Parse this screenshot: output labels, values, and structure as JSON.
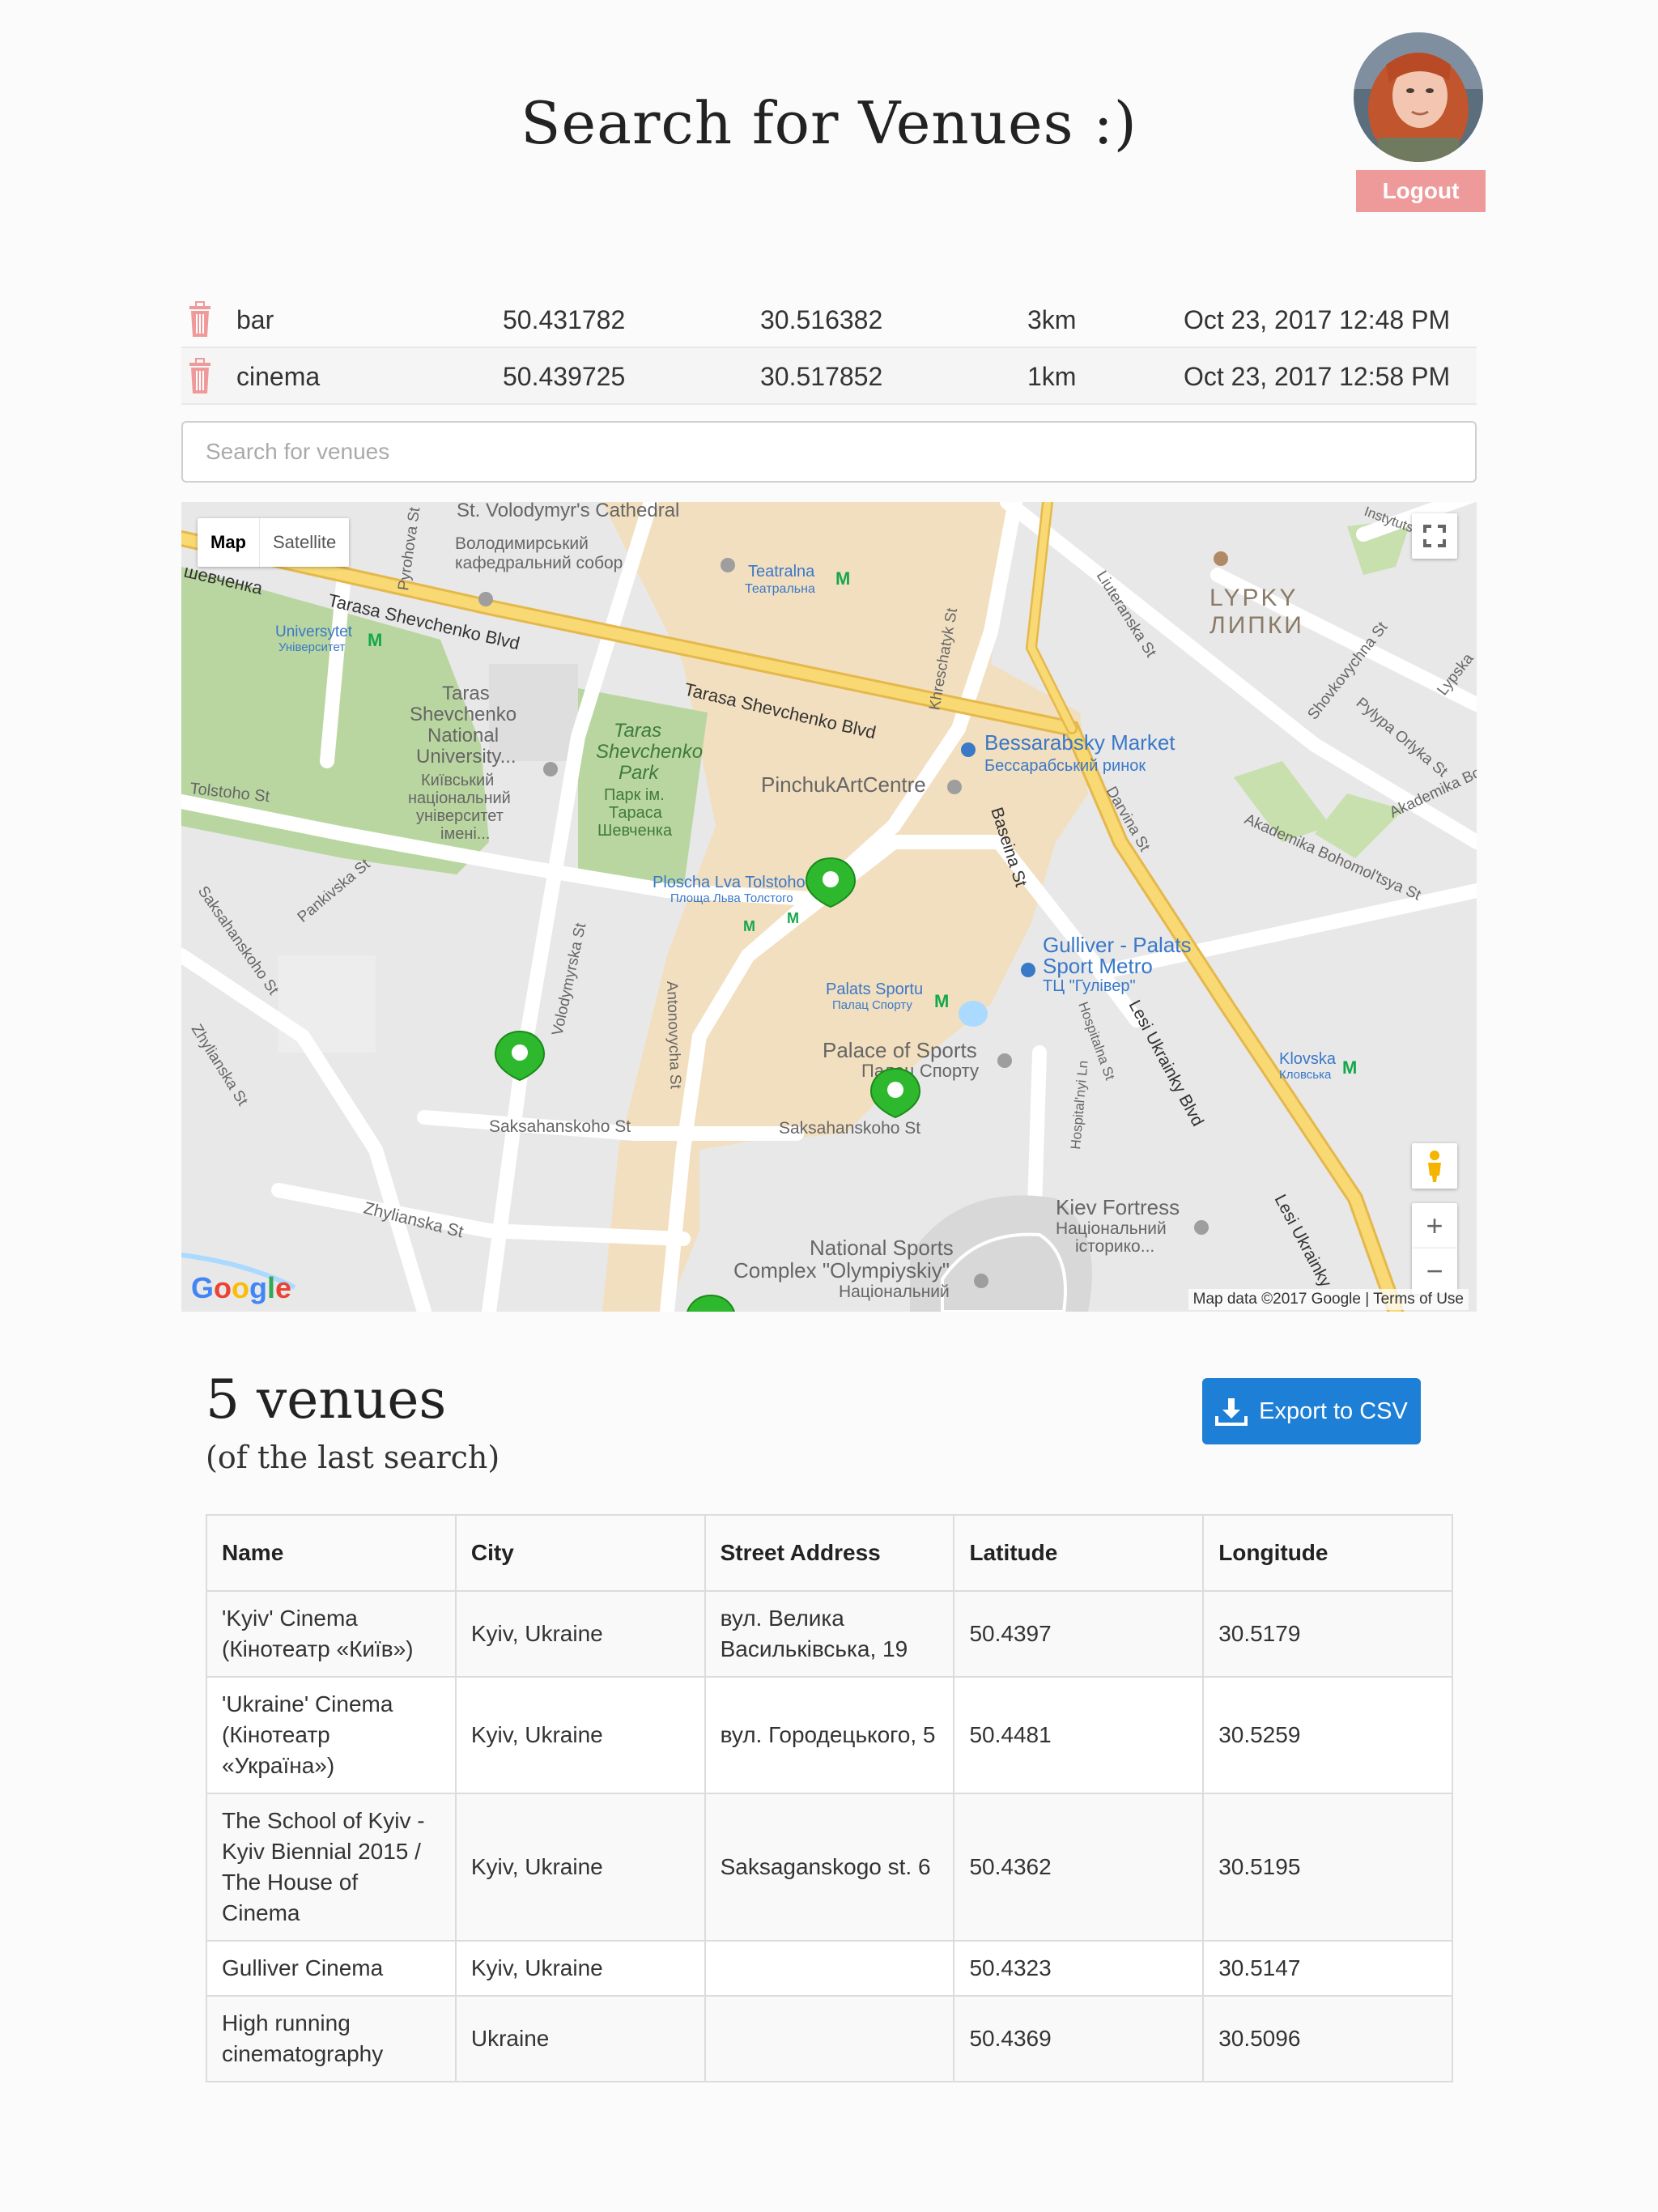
{
  "header": {
    "title": "Search for Venues :)",
    "logout_label": "Logout"
  },
  "history": [
    {
      "term": "bar",
      "lat": "50.431782",
      "lng": "30.516382",
      "radius": "3km",
      "date": "Oct 23, 2017 12:48 PM"
    },
    {
      "term": "cinema",
      "lat": "50.439725",
      "lng": "30.517852",
      "radius": "1km",
      "date": "Oct 23, 2017 12:58 PM"
    }
  ],
  "search": {
    "placeholder": "Search for venues",
    "value": ""
  },
  "map": {
    "type_map": "Map",
    "type_satellite": "Satellite",
    "footer": "Map data ©2017 Google | Terms of Use",
    "logo": "Google",
    "labels": {
      "cathedral": "St. Volodymyr's Cathedral",
      "cathedral_uk1": "Володимирський",
      "cathedral_uk2": "кафедральний собор",
      "teatralna": "Teatralna",
      "teatralna_uk": "Театральна",
      "lypky": "LYPKY",
      "lypky_uk": "ЛИПКИ",
      "shevchenko_blvd": "Tarasa Shevchenko Blvd",
      "shevchenko_blvd_uk": "шевченка",
      "universytet": "Universytet",
      "universytet_uk": "Університет",
      "university1": "Taras",
      "university2": "Shevchenko",
      "university3": "National",
      "university4": "University...",
      "university_uk1": "Київський",
      "university_uk2": "національний",
      "university_uk3": "університет",
      "university_uk4": "імені...",
      "park1": "Taras",
      "park2": "Shevchenko",
      "park3": "Park",
      "park_uk1": "Парк ім.",
      "park_uk2": "Тараса",
      "park_uk3": "Шевченка",
      "bessarabsky": "Bessarabsky Market",
      "bessarabsky_uk": "Бессарабський ринок",
      "pinchuk": "PinchukArtCentre",
      "khreschatyk": "Khreschatyk St",
      "luteranska": "Liuteranska St",
      "shovkovychna": "Shovkovychna St",
      "pylypa": "Pylypa Orlyka St",
      "lypska": "Lypska",
      "darvina": "Darvina St",
      "bohomoltsya": "Akademika Bohomol'tsya St",
      "baseina": "Baseina St",
      "tolstoho": "Tolstoho St",
      "pl_tolstoho": "Ploscha Lva Tolstoho",
      "pl_tolstoho_uk": "Площа Льва Толстого",
      "pankivska": "Pankivska St",
      "saksahanskoho": "Saksahanskoho St",
      "saksahanskoho2": "Saksahanskoho St",
      "saksahanskoho_diag": "Saksahanskoho St",
      "zhylianska": "Zhylianska St",
      "zhylianska2": "Zhylianska St",
      "volodymyrska": "Volodymyrska St",
      "antonovycha": "Antonovycha St",
      "pyrohova": "Pyrohova St",
      "gulliver1": "Gulliver - Palats",
      "gulliver2": "Sport Metro",
      "gulliver_uk": "ТЦ \"Гулівер\"",
      "palats_sportu": "Palats Sportu",
      "palats_sportu_uk": "Палац Спорту",
      "palace1": "Palace of Sports",
      "palace_uk": "Палац Спорту",
      "lesi": "Lesi Ukrainky Blvd",
      "lesi2": "Lesi Ukrainky",
      "klovska": "Klovska",
      "klovska_uk": "Кловська",
      "hospitalnyi": "Hospital'nyi Ln",
      "hospitalna": "Hospitalna St",
      "fortress1": "Kiev Fortress",
      "fortress_uk1": "Національний",
      "fortress_uk2": "історико...",
      "olymp1": "National Sports",
      "olymp2": "Complex \"Olympiyskiy\"",
      "olymp_uk": "Національний",
      "instytutska": "Instytutska"
    }
  },
  "results": {
    "count_label": "5 venues",
    "sub_label": "(of the last search)",
    "export_label": "Export to CSV",
    "columns": [
      "Name",
      "City",
      "Street Address",
      "Latitude",
      "Longitude"
    ],
    "rows": [
      {
        "name": "'Kyiv' Cinema (Кінотеатр «Київ»)",
        "city": "Kyiv, Ukraine",
        "street": "вул. Велика Васильківська, 19",
        "lat": "50.4397",
        "lng": "30.5179"
      },
      {
        "name": "'Ukraine' Cinema (Кінотеатр «Україна»)",
        "city": "Kyiv, Ukraine",
        "street": "вул. Городецького, 5",
        "lat": "50.4481",
        "lng": "30.5259"
      },
      {
        "name": "The School of Kyiv - Kyiv Biennial 2015 / The House of Cinema",
        "city": "Kyiv, Ukraine",
        "street": "Saksaganskogo st. 6",
        "lat": "50.4362",
        "lng": "30.5195"
      },
      {
        "name": "Gulliver Cinema",
        "city": "Kyiv, Ukraine",
        "street": "",
        "lat": "50.4323",
        "lng": "30.5147"
      },
      {
        "name": "High running cinematography",
        "city": "Ukraine",
        "street": "",
        "lat": "50.4369",
        "lng": "30.5096"
      }
    ]
  },
  "colors": {
    "accent": "#1e7fd6",
    "logout": "#ef9a9a",
    "marker": "#2db82d",
    "park": "#b7d7a0",
    "highway": "#f6cf65"
  },
  "icons": [
    "trash-icon",
    "download-icon",
    "fullscreen-icon",
    "pegman-icon",
    "zoom-in-icon",
    "zoom-out-icon",
    "map-marker-icon"
  ]
}
